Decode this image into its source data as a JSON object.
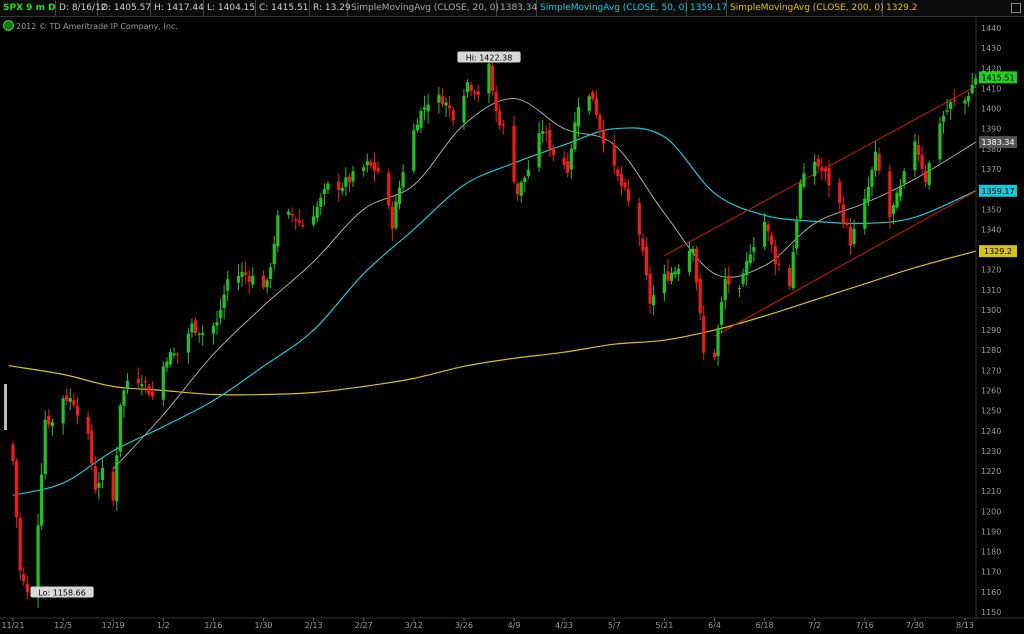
{
  "header": {
    "symbol": "SPX",
    "aggregation": "9 m D",
    "date": "D: 8/16/12",
    "open": "O: 1405.57",
    "high": "H: 1417.44",
    "low": "L: 1404.15",
    "close": "C: 1415.51",
    "range": "R: 13.29",
    "sma20_label": "SimpleMovingAvg (CLOSE, 20, 0)",
    "sma20_value": "1383.34",
    "sma50_label": "SimpleMovingAvg (CLOSE, 50, 0)",
    "sma50_value": "1359.17",
    "sma200_label": "SimpleMovingAvg (CLOSE, 200, 0)",
    "sma200_value": "1329.2"
  },
  "copyright": "2012 © TD Ameritrade IP Company, Inc.",
  "colors": {
    "background": "#000000",
    "up": "#22c022",
    "down": "#ee1c1c",
    "sma20": "#a8a8a8",
    "sma50": "#18c8d8",
    "sma200": "#d6c21a",
    "channel": "#d01818",
    "axis_text": "#9a9a9a"
  },
  "chart_data": {
    "type": "candlestick",
    "y_ticks": [
      1150,
      1160,
      1170,
      1180,
      1190,
      1200,
      1210,
      1220,
      1230,
      1240,
      1250,
      1260,
      1270,
      1280,
      1290,
      1300,
      1310,
      1320,
      1330,
      1340,
      1350,
      1360,
      1370,
      1380,
      1390,
      1400,
      1410,
      1420,
      1430,
      1440
    ],
    "x_ticks": [
      "11/21",
      "12/5",
      "12/19",
      "1/2",
      "1/16",
      "1/30",
      "2/13",
      "2/27",
      "3/12",
      "3/26",
      "4/9",
      "4/23",
      "5/7",
      "5/21",
      "6/4",
      "6/18",
      "7/2",
      "7/16",
      "7/30",
      "8/13"
    ],
    "ylim": [
      1148,
      1445
    ],
    "grid": false,
    "hi_label": "Hi: 1422.38",
    "lo_label": "Lo: 1158.66",
    "price_badges": [
      {
        "label": "1415.51",
        "value": 1415.51,
        "color": "#22cc22",
        "text": "#000000"
      },
      {
        "label": "1383.34",
        "value": 1383.34,
        "color": "#555555",
        "text": "#ffffff"
      },
      {
        "label": "1359.17",
        "value": 1359.17,
        "color": "#18c8d8",
        "text": "#000000"
      },
      {
        "label": "1329.2",
        "value": 1329.2,
        "color": "#d6c21a",
        "text": "#000000"
      }
    ],
    "candles_note": "OHLC generated from close anchor values",
    "close_anchors": [
      [
        "11/21",
        1225
      ],
      [
        "11/23",
        1170
      ],
      [
        "11/25",
        1158.66
      ],
      [
        "11/28",
        1195
      ],
      [
        "11/30",
        1246
      ],
      [
        "12/2",
        1244
      ],
      [
        "12/5",
        1257
      ],
      [
        "12/8",
        1255
      ],
      [
        "12/12",
        1236
      ],
      [
        "12/14",
        1212
      ],
      [
        "12/16",
        1219
      ],
      [
        "12/19",
        1205
      ],
      [
        "12/21",
        1254
      ],
      [
        "12/23",
        1265
      ],
      [
        "12/27",
        1266
      ],
      [
        "12/30",
        1257
      ],
      [
        "1/3",
        1277
      ],
      [
        "1/6",
        1278
      ],
      [
        "1/10",
        1292
      ],
      [
        "1/13",
        1289
      ],
      [
        "1/17",
        1293
      ],
      [
        "1/20",
        1315
      ],
      [
        "1/24",
        1318
      ],
      [
        "1/27",
        1316
      ],
      [
        "1/31",
        1312
      ],
      [
        "2/3",
        1345
      ],
      [
        "2/7",
        1347
      ],
      [
        "2/10",
        1342
      ],
      [
        "2/14",
        1351
      ],
      [
        "2/17",
        1361
      ],
      [
        "2/21",
        1362
      ],
      [
        "2/24",
        1366
      ],
      [
        "2/28",
        1372
      ],
      [
        "3/2",
        1369
      ],
      [
        "3/6",
        1343
      ],
      [
        "3/9",
        1370
      ],
      [
        "3/13",
        1395
      ],
      [
        "3/16",
        1404
      ],
      [
        "3/20",
        1405
      ],
      [
        "3/23",
        1397
      ],
      [
        "3/27",
        1413
      ],
      [
        "3/30",
        1408
      ],
      [
        "4/2",
        1420
      ],
      [
        "4/4",
        1398
      ],
      [
        "4/6",
        1390
      ],
      [
        "4/10",
        1358
      ],
      [
        "4/13",
        1370
      ],
      [
        "4/17",
        1390
      ],
      [
        "4/20",
        1378
      ],
      [
        "4/24",
        1371
      ],
      [
        "4/27",
        1403
      ],
      [
        "5/1",
        1406
      ],
      [
        "5/3",
        1391
      ],
      [
        "5/7",
        1369
      ],
      [
        "5/10",
        1358
      ],
      [
        "5/14",
        1338
      ],
      [
        "5/17",
        1304
      ],
      [
        "5/21",
        1316
      ],
      [
        "5/24",
        1320
      ],
      [
        "5/29",
        1333
      ],
      [
        "6/1",
        1278
      ],
      [
        "6/4",
        1278
      ],
      [
        "6/7",
        1315
      ],
      [
        "6/11",
        1308
      ],
      [
        "6/14",
        1330
      ],
      [
        "6/18",
        1344
      ],
      [
        "6/21",
        1325
      ],
      [
        "6/25",
        1313
      ],
      [
        "6/28",
        1362
      ],
      [
        "7/2",
        1374
      ],
      [
        "7/5",
        1367
      ],
      [
        "7/9",
        1352
      ],
      [
        "7/12",
        1334
      ],
      [
        "7/16",
        1353
      ],
      [
        "7/19",
        1376
      ],
      [
        "7/23",
        1346
      ],
      [
        "7/26",
        1360
      ],
      [
        "7/30",
        1385
      ],
      [
        "8/2",
        1365
      ],
      [
        "8/6",
        1394
      ],
      [
        "8/9",
        1402
      ],
      [
        "8/13",
        1404
      ],
      [
        "8/16",
        1415.51
      ]
    ],
    "sma20_series": [
      [
        "12/19",
        1221
      ],
      [
        "1/2",
        1248
      ],
      [
        "1/16",
        1278
      ],
      [
        "1/30",
        1302
      ],
      [
        "2/13",
        1324
      ],
      [
        "2/27",
        1350
      ],
      [
        "3/12",
        1362
      ],
      [
        "3/26",
        1392
      ],
      [
        "4/9",
        1405
      ],
      [
        "4/23",
        1390
      ],
      [
        "5/7",
        1382
      ],
      [
        "5/21",
        1348
      ],
      [
        "6/4",
        1318
      ],
      [
        "6/18",
        1322
      ],
      [
        "7/2",
        1343
      ],
      [
        "7/16",
        1353
      ],
      [
        "7/30",
        1365
      ],
      [
        "8/16",
        1383.34
      ]
    ],
    "sma50_series": [
      [
        "11/21",
        1208
      ],
      [
        "12/5",
        1214
      ],
      [
        "12/19",
        1230
      ],
      [
        "1/2",
        1242
      ],
      [
        "1/16",
        1255
      ],
      [
        "1/30",
        1272
      ],
      [
        "2/13",
        1290
      ],
      [
        "2/27",
        1318
      ],
      [
        "3/12",
        1340
      ],
      [
        "3/26",
        1362
      ],
      [
        "4/9",
        1373
      ],
      [
        "4/23",
        1382
      ],
      [
        "5/7",
        1390
      ],
      [
        "5/21",
        1386
      ],
      [
        "6/4",
        1358
      ],
      [
        "6/18",
        1347
      ],
      [
        "7/2",
        1344
      ],
      [
        "7/16",
        1343
      ],
      [
        "7/30",
        1346
      ],
      [
        "8/16",
        1359.17
      ]
    ],
    "sma200_series": [
      [
        "11/21",
        1272
      ],
      [
        "12/5",
        1268
      ],
      [
        "12/19",
        1262
      ],
      [
        "1/2",
        1260
      ],
      [
        "1/16",
        1258
      ],
      [
        "1/30",
        1258
      ],
      [
        "2/13",
        1259
      ],
      [
        "2/27",
        1262
      ],
      [
        "3/12",
        1266
      ],
      [
        "3/26",
        1272
      ],
      [
        "4/9",
        1276
      ],
      [
        "4/23",
        1279
      ],
      [
        "5/7",
        1283
      ],
      [
        "5/21",
        1285
      ],
      [
        "6/4",
        1290
      ],
      [
        "6/18",
        1297
      ],
      [
        "7/2",
        1305
      ],
      [
        "7/16",
        1313
      ],
      [
        "7/30",
        1321
      ],
      [
        "8/16",
        1329.2
      ]
    ],
    "channel_lines": [
      {
        "from": [
          "5/21",
          1327
        ],
        "to": [
          "8/16",
          1411
        ]
      },
      {
        "from": [
          "6/4",
          1287
        ],
        "to": [
          "8/16",
          1359
        ]
      }
    ]
  }
}
